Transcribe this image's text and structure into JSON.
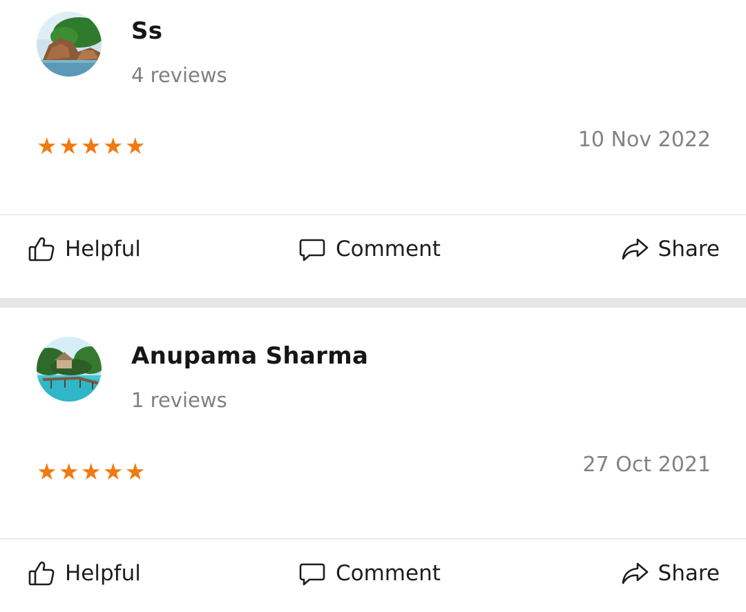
{
  "reviews": [
    {
      "name": "Ss",
      "review_count": "4 reviews",
      "date": "10 Nov 2022",
      "rating": 5,
      "avatar_icon": "rocky-beach-avatar"
    },
    {
      "name": "Anupama Sharma",
      "review_count": "1 reviews",
      "date": "27 Oct 2021",
      "rating": 5,
      "avatar_icon": "tropical-resort-avatar"
    }
  ],
  "actions": {
    "helpful_label": "Helpful",
    "comment_label": "Comment",
    "share_label": "Share"
  },
  "colors": {
    "star": "#f07a12",
    "muted_text": "#808080",
    "separator": "#e6e6e6"
  }
}
